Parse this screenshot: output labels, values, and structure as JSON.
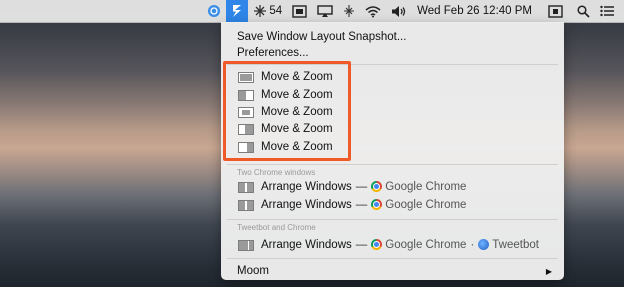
{
  "menubar": {
    "moom_icon": "moom-icon",
    "temperature": "54",
    "datetime": "Wed Feb 26 12:40 PM",
    "icons": [
      "status-circle-icon",
      "weather-icon",
      "display-icon",
      "airplay-icon",
      "bluetooth-icon",
      "wifi-icon",
      "volume-icon",
      "screen-icon",
      "spotlight-icon",
      "list-icon"
    ]
  },
  "menu": {
    "top_items": [
      "Save Window Layout Snapshot...",
      "Preferences..."
    ],
    "move_zoom_items": [
      "Move & Zoom",
      "Move & Zoom",
      "Move & Zoom",
      "Move & Zoom",
      "Move & Zoom"
    ],
    "groups": [
      {
        "header": "Two Chrome windows",
        "items": [
          {
            "label": "Arrange Windows",
            "dash": "—",
            "app": "Google Chrome"
          },
          {
            "label": "Arrange Windows",
            "dash": "—",
            "app": "Google Chrome"
          }
        ]
      },
      {
        "header": "Tweetbot and Chrome",
        "items": [
          {
            "label": "Arrange Windows",
            "dash": "—",
            "app": "Google Chrome",
            "sep2": "·",
            "app2": "Tweetbot"
          }
        ]
      }
    ],
    "bottom_item": "Moom",
    "submenu_arrow": "▶"
  },
  "highlight_color": "#f05a28"
}
